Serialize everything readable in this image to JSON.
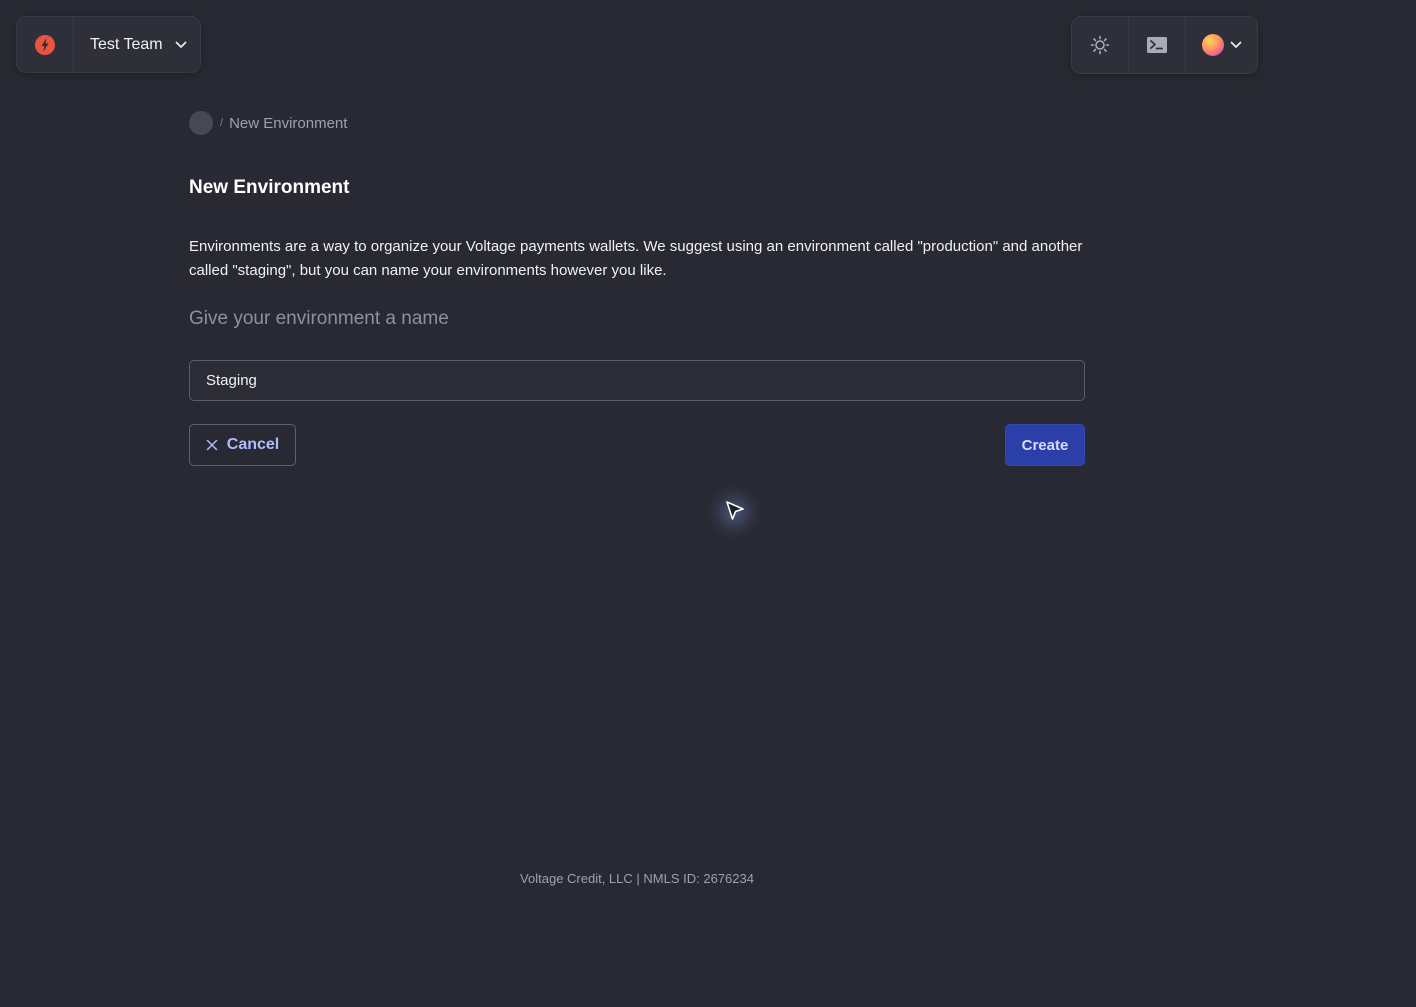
{
  "team": {
    "name": "Test Team",
    "logo_icon": "voltage-logo-icon",
    "brand_color": "#e8553f"
  },
  "top_actions": {
    "theme_icon": "sun-icon",
    "terminal_icon": "terminal-icon",
    "account_icon": "user-avatar"
  },
  "breadcrumb": {
    "separator": "/",
    "current": "New Environment"
  },
  "page": {
    "title": "New Environment",
    "description": "Environments are a way to organize your Voltage payments wallets. We suggest using an environment called \"production\" and another called \"staging\", but you can name your environments however you like.",
    "field_label": "Give your environment a name"
  },
  "form": {
    "name_value": "Staging",
    "cancel_label": "Cancel",
    "create_label": "Create",
    "accent_color": "#2b3fa8"
  },
  "footer": {
    "text": "Voltage Credit, LLC | NMLS ID: 2676234"
  }
}
